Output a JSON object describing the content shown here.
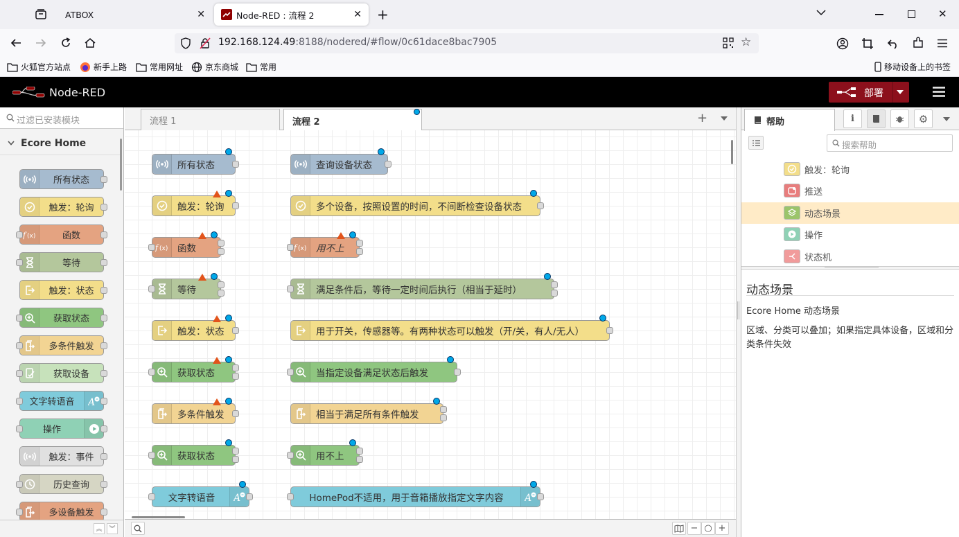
{
  "browser": {
    "tabs": [
      {
        "title": "ATBOX",
        "active": false
      },
      {
        "title": "Node-RED : 流程 2",
        "active": true
      }
    ],
    "url_host": "192.168.124.49",
    "url_rest": ":8188/nodered/#flow/0c61dace8bac7905",
    "bookmarks": [
      "火狐官方站点",
      "新手上路",
      "常用网址",
      "京东商城",
      "常用"
    ],
    "mobile_bookmarks": "移动设备上的书签"
  },
  "app": {
    "name": "Node-RED",
    "deploy_label": "部署",
    "header_bg": "#000000",
    "deploy_color": "#8c101c"
  },
  "palette": {
    "filter_placeholder": "过滤已安装模块",
    "category": "Ecore Home",
    "nodes": [
      {
        "label": "所有状态",
        "color": "#a6bbcf",
        "icon": "radio-icon"
      },
      {
        "label": "触发：轮询",
        "color": "#f3de8a",
        "icon": "check-circle-icon"
      },
      {
        "label": "函数",
        "color": "#e4a381",
        "icon": "function-icon"
      },
      {
        "label": "等待",
        "color": "#b4c79c",
        "icon": "hourglass-icon"
      },
      {
        "label": "触发：状态",
        "color": "#f3de8a",
        "icon": "exit-icon"
      },
      {
        "label": "获取状态",
        "color": "#8fc680",
        "icon": "zoom-in-icon"
      },
      {
        "label": "多条件触发",
        "color": "#f2d493",
        "icon": "copy-exit-icon"
      },
      {
        "label": "获取设备",
        "color": "#c7e2bb",
        "icon": "device-check-icon"
      },
      {
        "label": "文字转语音",
        "color": "#7fcbdb",
        "icon": "tts-icon"
      },
      {
        "label": "操作",
        "color": "#8fd1b5",
        "icon": "play-icon"
      },
      {
        "label": "触发：事件",
        "color": "#e0e0e0",
        "icon": "radio-icon"
      },
      {
        "label": "历史查询",
        "color": "#d6d6c4",
        "icon": "clock-icon"
      },
      {
        "label": "多设备触发",
        "color": "#e4a381",
        "icon": "copy-exit-icon"
      }
    ]
  },
  "workspace": {
    "tabs": [
      "流程 1",
      "流程 2"
    ],
    "active_tab": "流程 2",
    "left_nodes": [
      "所有状态",
      "触发：轮询",
      "函数",
      "等待",
      "触发：状态",
      "获取状态",
      "多条件触发",
      "获取状态",
      "文字转语音"
    ],
    "right_nodes": [
      "查询设备状态",
      "多个设备，按照设置的时间，不间断检查设备状态",
      "用不上",
      "满足条件后，等待一定时间后执行（相当于延时）",
      "用于开关，传感器等。有两种状态可以触发（开/关，有人/无人）",
      "当指定设备满足状态后触发",
      "相当于满足所有条件触发",
      "用不上",
      "HomePod不适用，用于音箱播放指定文字内容"
    ]
  },
  "sidebar": {
    "tab_label": "帮助",
    "search_placeholder": "搜索帮助",
    "help_items": [
      "触发：轮询",
      "推送",
      "动态场景",
      "操作",
      "状态机"
    ],
    "selected_item": "动态场景",
    "help_title": "动态场景",
    "help_subtitle": "Ecore Home 动态场景",
    "help_body": "区域、分类可以叠加；如果指定具体设备，区域和分类条件失效"
  }
}
